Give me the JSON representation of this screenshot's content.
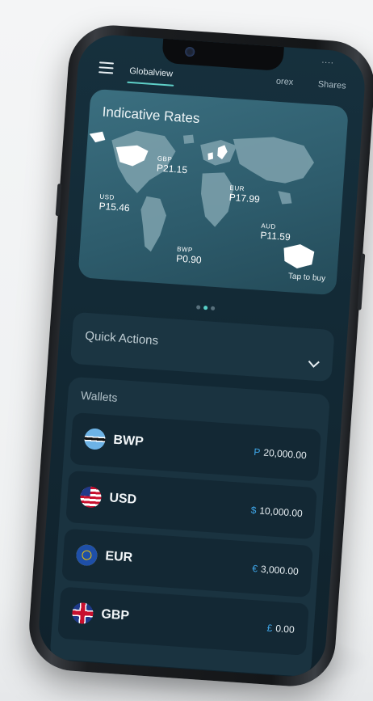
{
  "tabs": [
    {
      "label": "Globalview",
      "active": true
    },
    {
      "label": "orex",
      "active": false
    },
    {
      "label": "Shares",
      "active": false
    }
  ],
  "status_dots": "....",
  "rates_card": {
    "title": "Indicative Rates",
    "rates": [
      {
        "code": "GBP",
        "value": "P21.15"
      },
      {
        "code": "USD",
        "value": "P15.46"
      },
      {
        "code": "EUR",
        "value": "P17.99"
      },
      {
        "code": "AUD",
        "value": "P11.59"
      },
      {
        "code": "BWP",
        "value": "P0.90"
      }
    ],
    "cta": "Tap to buy"
  },
  "pager": {
    "count": 3,
    "active_index": 1
  },
  "quick_actions": {
    "label": "Quick Actions",
    "icon": "chevron-down-icon"
  },
  "wallets": {
    "title": "Wallets",
    "items": [
      {
        "code": "BWP",
        "symbol": "P",
        "amount": "20,000.00",
        "flag": "botswana-flag-icon"
      },
      {
        "code": "USD",
        "symbol": "$",
        "amount": "10,000.00",
        "flag": "usa-flag-icon"
      },
      {
        "code": "EUR",
        "symbol": "€",
        "amount": "3,000.00",
        "flag": "eu-flag-icon"
      },
      {
        "code": "GBP",
        "symbol": "£",
        "amount": "0.00",
        "flag": "uk-flag-icon"
      }
    ]
  },
  "colors": {
    "accent": "#5fd0c8",
    "amount_symbol": "#3fa6e8",
    "card_bg": "#2d5b6b",
    "screen_bg": "#132a36"
  }
}
